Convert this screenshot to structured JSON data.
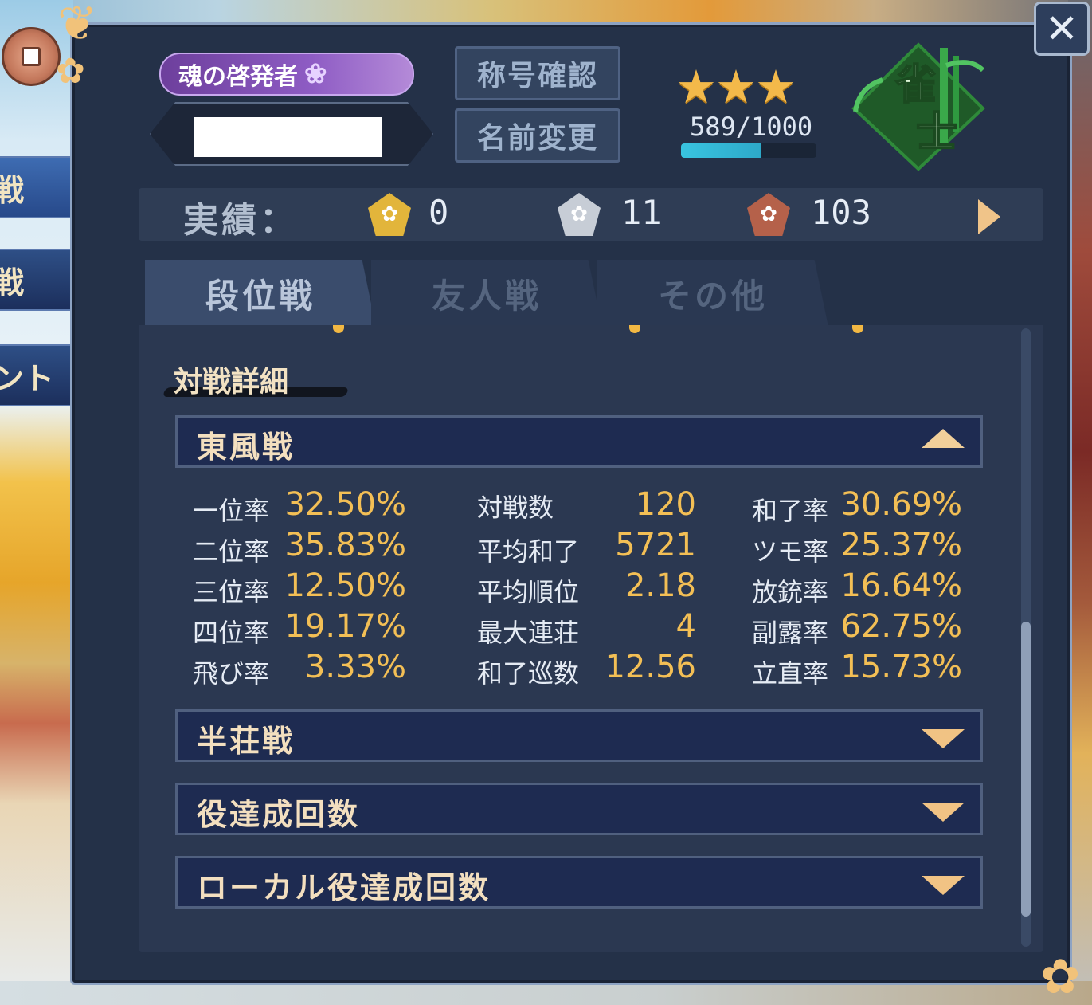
{
  "sidebar": {
    "tabs": [
      "戦",
      "戦",
      "ント"
    ]
  },
  "profile": {
    "title_badge": "魂の啓発者",
    "title_check_button": "称号確認",
    "rename_button": "名前変更",
    "rank_name": "雀士",
    "stars": 3,
    "exp_text": "589/1000",
    "exp_fraction": 0.589
  },
  "achievements": {
    "label": "実績：",
    "gold": "0",
    "silver": "11",
    "bronze": "103"
  },
  "tabs": [
    "段位戦",
    "友人戦",
    "その他"
  ],
  "details": {
    "section_title": "対戦詳細",
    "sections": [
      "東風戦",
      "半荘戦",
      "役達成回数",
      "ローカル役達成回数"
    ],
    "col1": [
      {
        "label": "一位率",
        "value": "32.50%"
      },
      {
        "label": "二位率",
        "value": "35.83%"
      },
      {
        "label": "三位率",
        "value": "12.50%"
      },
      {
        "label": "四位率",
        "value": "19.17%"
      },
      {
        "label": "飛び率",
        "value": "3.33%"
      }
    ],
    "col2": [
      {
        "label": "対戦数",
        "value": "120"
      },
      {
        "label": "平均和了",
        "value": "5721"
      },
      {
        "label": "平均順位",
        "value": "2.18"
      },
      {
        "label": "最大連荘",
        "value": "4"
      },
      {
        "label": "和了巡数",
        "value": "12.56"
      }
    ],
    "col3": [
      {
        "label": "和了率",
        "value": "30.69%"
      },
      {
        "label": "ツモ率",
        "value": "25.37%"
      },
      {
        "label": "放銃率",
        "value": "16.64%"
      },
      {
        "label": "副露率",
        "value": "62.75%"
      },
      {
        "label": "立直率",
        "value": "15.73%"
      }
    ]
  },
  "colors": {
    "accent_gold": "#f3bf55",
    "panel": "#243148",
    "accordion": "#1e2b51"
  }
}
